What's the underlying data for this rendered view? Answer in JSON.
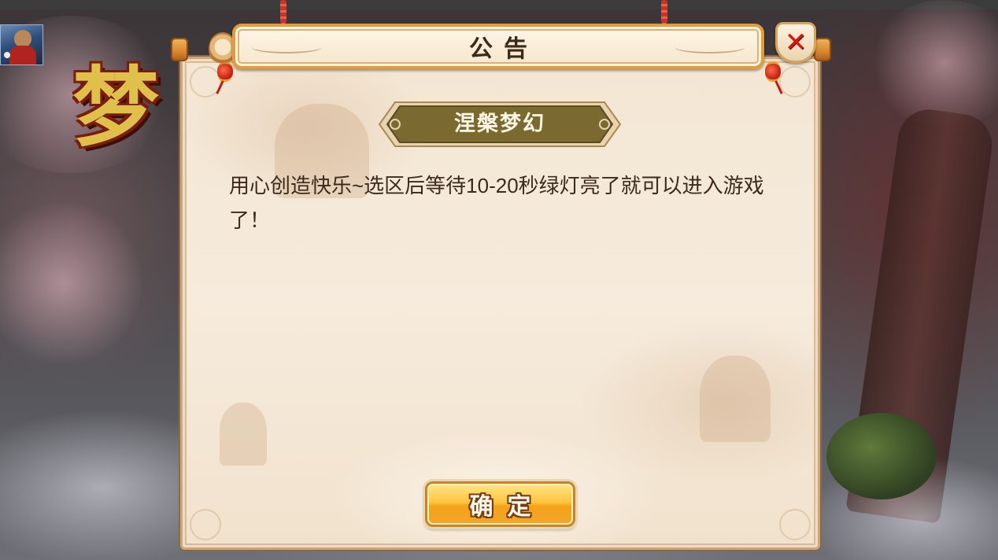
{
  "background": {
    "logo_text": "梦幻"
  },
  "dialog": {
    "title": "公告",
    "close_label": "✕",
    "banner_title": "涅槃梦幻",
    "message": "用心创造快乐~选区后等待10-20秒绿灯亮了就可以进入游戏了！",
    "confirm_label": "确定"
  },
  "icons": {
    "close": "close-icon",
    "avatar": "player-avatar"
  },
  "colors": {
    "accent_gold": "#f5a21b",
    "close_red": "#d11a14",
    "banner_brown": "#7a6a2f",
    "parchment": "#f3e6d3",
    "text": "#3c2a1c"
  }
}
